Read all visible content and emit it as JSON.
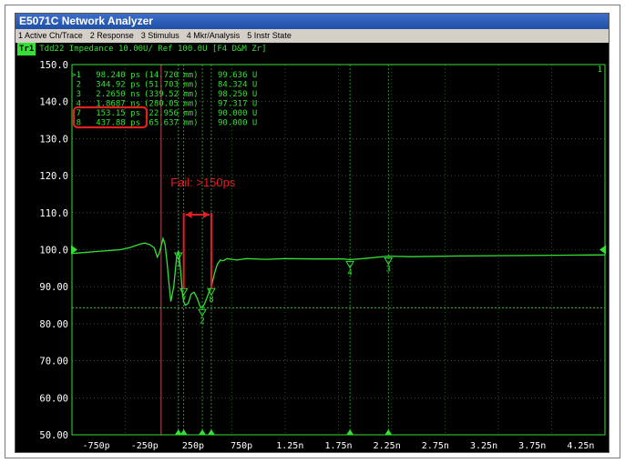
{
  "window": {
    "title": "E5071C Network Analyzer"
  },
  "menu": [
    {
      "label": "1 Active Ch/Trace"
    },
    {
      "label": "2 Response"
    },
    {
      "label": "3 Stimulus"
    },
    {
      "label": "4 Mkr/Analysis"
    },
    {
      "label": "5 Instr State"
    }
  ],
  "trace": {
    "badge": "Tr1",
    "header": "Tdd22 Impedance 10.00U/ Ref 100.0U [F4 D&M Zr]",
    "end_label": "1"
  },
  "markers_table": [
    {
      "id": ">1",
      "time": "98.240 ps",
      "dist": "(14.720 mm)",
      "value": "99.636 U"
    },
    {
      "id": "2",
      "time": "344.92 ps",
      "dist": "(51.703 mm)",
      "value": "84.324 U"
    },
    {
      "id": "3",
      "time": "2.2650 ns",
      "dist": "(339.52 mm)",
      "value": "98.250 U"
    },
    {
      "id": "4",
      "time": "1.8687 ns",
      "dist": "(280.05 mm)",
      "value": "97.317 U"
    },
    {
      "id": "7",
      "time": "153.15 ps",
      "dist": "(22.956 mm)",
      "value": "90.000 U"
    },
    {
      "id": "8",
      "time": "437.88 ps",
      "dist": "(65.637 mm)",
      "value": "90.000 U"
    }
  ],
  "annotation": {
    "text": "Fail: >150ps",
    "color": "#e02020"
  },
  "chart_data": {
    "type": "line",
    "yticks": [
      "150.0",
      "140.0",
      "130.0",
      "120.0",
      "110.0",
      "100.0",
      "90.00",
      "80.00",
      "70.00",
      "60.00",
      "50.00"
    ],
    "xticks": [
      "-750p",
      "-250p",
      "250p",
      "750p",
      "1.25n",
      "1.75n",
      "2.25n",
      "2.75n",
      "3.25n",
      "3.75n",
      "4.25n"
    ],
    "xlim": [
      -1000,
      4500
    ],
    "ylim": [
      50,
      150
    ],
    "reference_value": 100,
    "series": [
      {
        "color": "#35e035",
        "x": [
          -1000,
          -900,
          -700,
          -500,
          -400,
          -300,
          -250,
          -200,
          -150,
          -120,
          -100,
          -80,
          -60,
          -40,
          -20,
          0,
          20,
          50,
          80,
          98,
          110,
          125,
          140,
          153,
          170,
          200,
          230,
          260,
          290,
          320,
          345,
          370,
          400,
          420,
          438,
          460,
          480,
          500,
          530,
          560,
          600,
          700,
          800,
          1000,
          1200,
          1500,
          1800,
          1870,
          2000,
          2265,
          2500,
          3000,
          3500,
          4000,
          4500
        ],
        "y": [
          99.0,
          99.2,
          99.6,
          100.0,
          100.6,
          101.5,
          101.8,
          101.4,
          100.5,
          98.0,
          99.0,
          101.0,
          103.0,
          101.5,
          97.0,
          91.0,
          86.0,
          90.0,
          98.0,
          99.6,
          97.5,
          93.0,
          88.0,
          86.0,
          85.0,
          85.5,
          88.0,
          88.5,
          87.0,
          84.8,
          84.3,
          85.5,
          87.5,
          89.0,
          90.0,
          92.5,
          94.5,
          96.0,
          97.2,
          97.0,
          97.6,
          97.2,
          97.6,
          97.4,
          97.6,
          97.5,
          97.5,
          97.3,
          97.6,
          98.25,
          98.1,
          98.3,
          98.4,
          98.5,
          98.6
        ]
      }
    ],
    "markers": [
      {
        "label": "1",
        "x": 98.24,
        "y": 99.636
      },
      {
        "label": "2",
        "x": 344.92,
        "y": 84.324
      },
      {
        "label": "3",
        "x": 2265,
        "y": 98.25
      },
      {
        "label": "4",
        "x": 1868.7,
        "y": 97.317
      },
      {
        "label": "7",
        "x": 153.15,
        "y": 90.0
      },
      {
        "label": "8",
        "x": 437.88,
        "y": 90.0
      }
    ]
  }
}
